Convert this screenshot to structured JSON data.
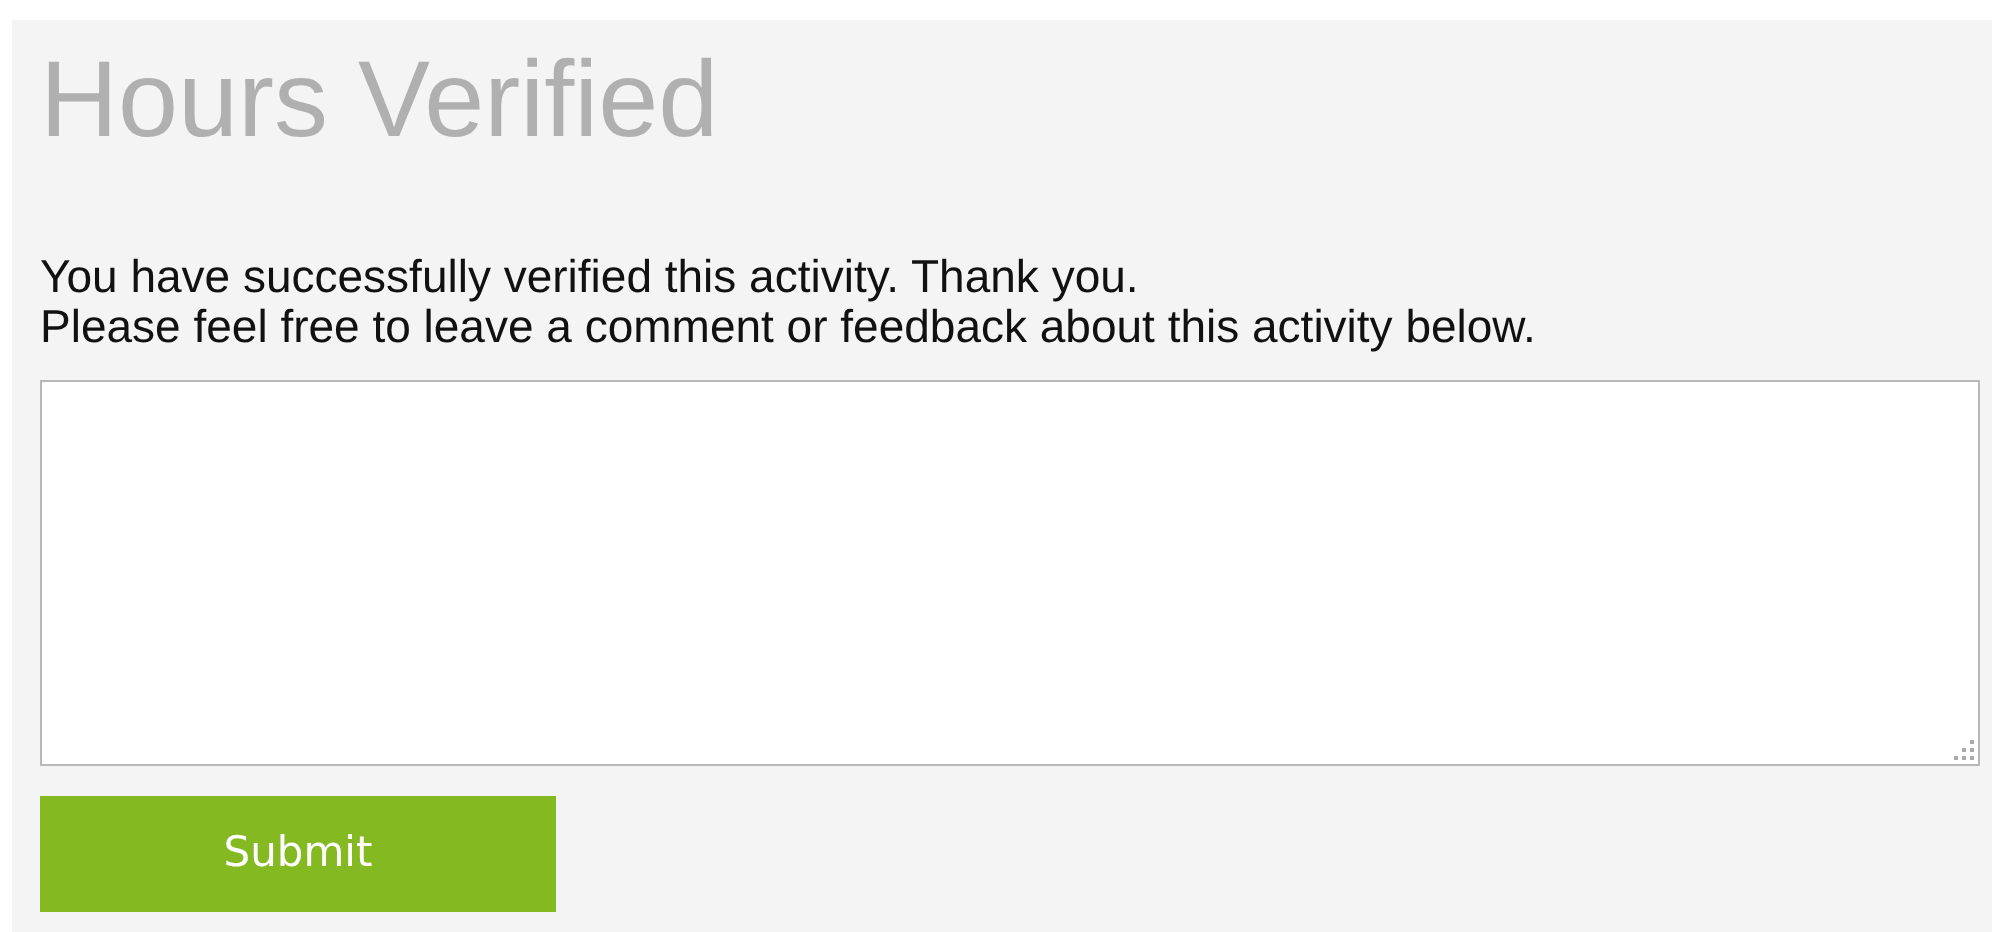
{
  "heading": "Hours Verified",
  "messages": [
    "You have successfully verified this activity. Thank you.",
    "Please feel free to leave a comment or feedback about this activity below."
  ],
  "button": "Submit"
}
